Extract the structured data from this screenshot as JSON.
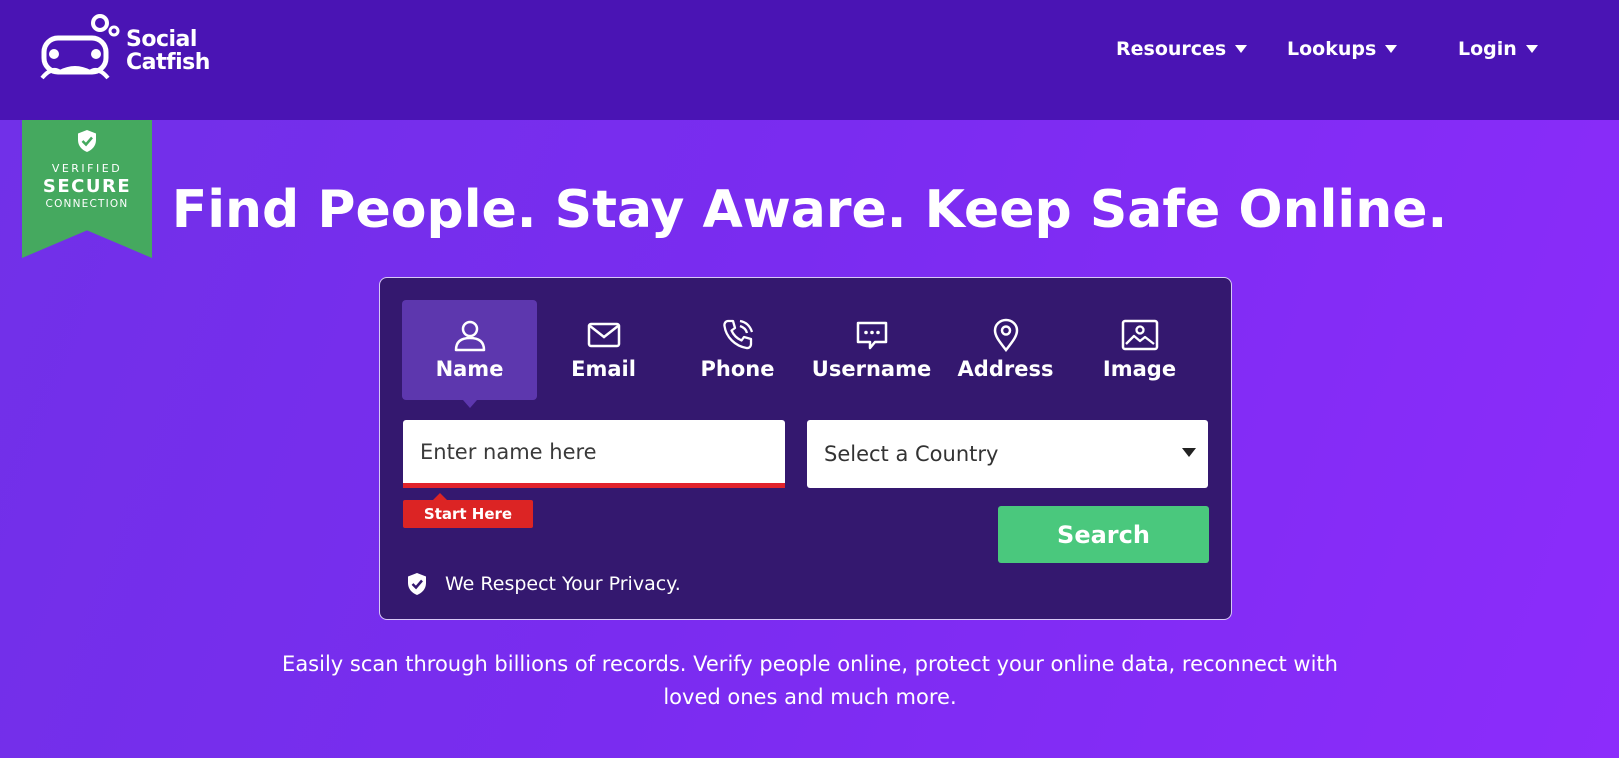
{
  "brand": {
    "logo_line1": "Social",
    "logo_line2": "Catfish"
  },
  "nav": {
    "resources": "Resources",
    "lookups": "Lookups",
    "login": "Login"
  },
  "badge": {
    "line1": "VERIFIED",
    "line2": "SECURE",
    "line3": "CONNECTION"
  },
  "hero": {
    "headline": "Find People. Stay Aware. Keep Safe Online.",
    "subtext": "Easily scan through billions of records. Verify people online, protect your online data, reconnect with loved ones and much more."
  },
  "search": {
    "tabs": [
      {
        "label": "Name",
        "icon": "person-icon",
        "active": true
      },
      {
        "label": "Email",
        "icon": "envelope-icon",
        "active": false
      },
      {
        "label": "Phone",
        "icon": "phone-icon",
        "active": false
      },
      {
        "label": "Username",
        "icon": "chat-bubble-icon",
        "active": false
      },
      {
        "label": "Address",
        "icon": "map-pin-icon",
        "active": false
      },
      {
        "label": "Image",
        "icon": "image-icon",
        "active": false
      }
    ],
    "name_placeholder": "Enter name here",
    "start_here": "Start Here",
    "country_placeholder": "Select a Country",
    "button": "Search",
    "privacy": "We Respect Your Privacy."
  },
  "colors": {
    "header_bg": "#4a14b4",
    "hero_bg": "#7a2cf0",
    "panel_bg": "#34186f",
    "badge_green": "#45a95f",
    "search_green": "#4ac87d",
    "alert_red": "#dc2424"
  }
}
